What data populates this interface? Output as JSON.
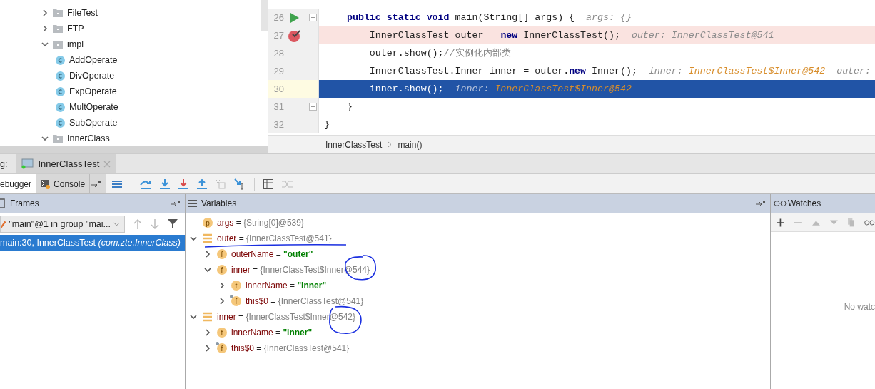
{
  "project_tree": {
    "items": [
      {
        "name": "FileTest",
        "kind": "package",
        "expanded": false
      },
      {
        "name": "FTP",
        "kind": "package",
        "expanded": false
      },
      {
        "name": "impl",
        "kind": "package",
        "expanded": true,
        "children": [
          {
            "name": "AddOperate",
            "kind": "class"
          },
          {
            "name": "DivOperate",
            "kind": "class"
          },
          {
            "name": "ExpOperate",
            "kind": "class"
          },
          {
            "name": "MultOperate",
            "kind": "class"
          },
          {
            "name": "SubOperate",
            "kind": "class"
          }
        ]
      },
      {
        "name": "InnerClass",
        "kind": "package",
        "expanded": true
      }
    ]
  },
  "editor": {
    "lines": [
      {
        "number": "26",
        "kind": "run",
        "fold": true,
        "segments": [
          {
            "kind": "kw",
            "text": "    public static void "
          },
          {
            "kind": "code",
            "text": "main(String[] args) {  "
          },
          {
            "kind": "hint",
            "text": "args: {}"
          }
        ]
      },
      {
        "number": "27",
        "kind": "breakpoint",
        "fold": false,
        "segments": [
          {
            "kind": "code",
            "text": "        InnerClassTest outer = "
          },
          {
            "kind": "kw",
            "text": "new "
          },
          {
            "kind": "code",
            "text": "InnerClassTest();  "
          },
          {
            "kind": "hint",
            "text": "outer: InnerClassTest@541"
          }
        ]
      },
      {
        "number": "28",
        "kind": "plain",
        "fold": false,
        "segments": [
          {
            "kind": "code",
            "text": "        outer.show();"
          },
          {
            "kind": "comment",
            "text": "//实例化内部类"
          }
        ]
      },
      {
        "number": "29",
        "kind": "plain",
        "fold": false,
        "segments": [
          {
            "kind": "code",
            "text": "        InnerClassTest.Inner inner = outer."
          },
          {
            "kind": "kw",
            "text": "new "
          },
          {
            "kind": "code",
            "text": "Inner();  "
          },
          {
            "kind": "hint",
            "text": "inner: "
          },
          {
            "kind": "hint-ref",
            "text": "InnerClassTest$Inner@542"
          },
          {
            "kind": "hint",
            "text": "  outer:"
          }
        ]
      },
      {
        "number": "30",
        "kind": "current",
        "fold": false,
        "segments": [
          {
            "kind": "code",
            "text": "        inner.show();  "
          },
          {
            "kind": "hint",
            "text": "inner: "
          },
          {
            "kind": "hint-ref",
            "text": "InnerClassTest$Inner@542"
          }
        ]
      },
      {
        "number": "31",
        "kind": "plain",
        "fold": true,
        "segments": [
          {
            "kind": "code",
            "text": "    }"
          }
        ]
      },
      {
        "number": "32",
        "kind": "plain",
        "fold": false,
        "segments": [
          {
            "kind": "code",
            "text": "}"
          }
        ]
      }
    ],
    "breadcrumb": [
      "InnerClassTest",
      "main()"
    ]
  },
  "debug": {
    "label": "g:",
    "session_tab": {
      "title": "InnerClassTest",
      "selected": true
    },
    "tabs": [
      {
        "label": "ebugger",
        "selected": true
      },
      {
        "label": "Console",
        "selected": false
      }
    ],
    "frames": {
      "title": "Frames",
      "thread": "\"main\"@1 in group \"mai...",
      "items": [
        {
          "text": "main:30, InnerClassTest",
          "package": "(com.zte.InnerClass)",
          "selected": true
        }
      ]
    },
    "variables": {
      "title": "Variables",
      "items": [
        {
          "name": "args",
          "kind": "param",
          "badge": "p",
          "op": "=",
          "value": "{String[0]@539}",
          "string_value": false
        },
        {
          "name": "outer",
          "kind": "local",
          "op": "=",
          "value": "{InnerClassTest@541}",
          "string_value": false,
          "expanded": true,
          "children": [
            {
              "name": "outerName",
              "kind": "field",
              "badge": "f",
              "op": "=",
              "value": "\"outer\"",
              "string_value": true,
              "expanded": false
            },
            {
              "name": "inner",
              "kind": "field",
              "badge": "f",
              "op": "=",
              "value": "{InnerClassTest$Inner@544}",
              "string_value": false,
              "expanded": true,
              "children": [
                {
                  "name": "innerName",
                  "kind": "field",
                  "badge": "f",
                  "op": "=",
                  "value": "\"inner\"",
                  "string_value": true,
                  "expanded": false
                },
                {
                  "name": "this$0",
                  "kind": "outer-field",
                  "badge": "f",
                  "op": "=",
                  "value": "{InnerClassTest@541}",
                  "string_value": false,
                  "expanded": false
                }
              ]
            }
          ]
        },
        {
          "name": "inner",
          "kind": "local",
          "op": "=",
          "value": "{InnerClassTest$Inner@542}",
          "string_value": false,
          "expanded": true,
          "children": [
            {
              "name": "innerName",
              "kind": "field",
              "badge": "f",
              "op": "=",
              "value": "\"inner\"",
              "string_value": true,
              "expanded": false
            },
            {
              "name": "this$0",
              "kind": "outer-field",
              "badge": "f",
              "op": "=",
              "value": "{InnerClassTest@541}",
              "string_value": false,
              "expanded": false
            }
          ]
        }
      ]
    },
    "watches": {
      "title": "Watches",
      "empty_text": "No watc"
    }
  }
}
